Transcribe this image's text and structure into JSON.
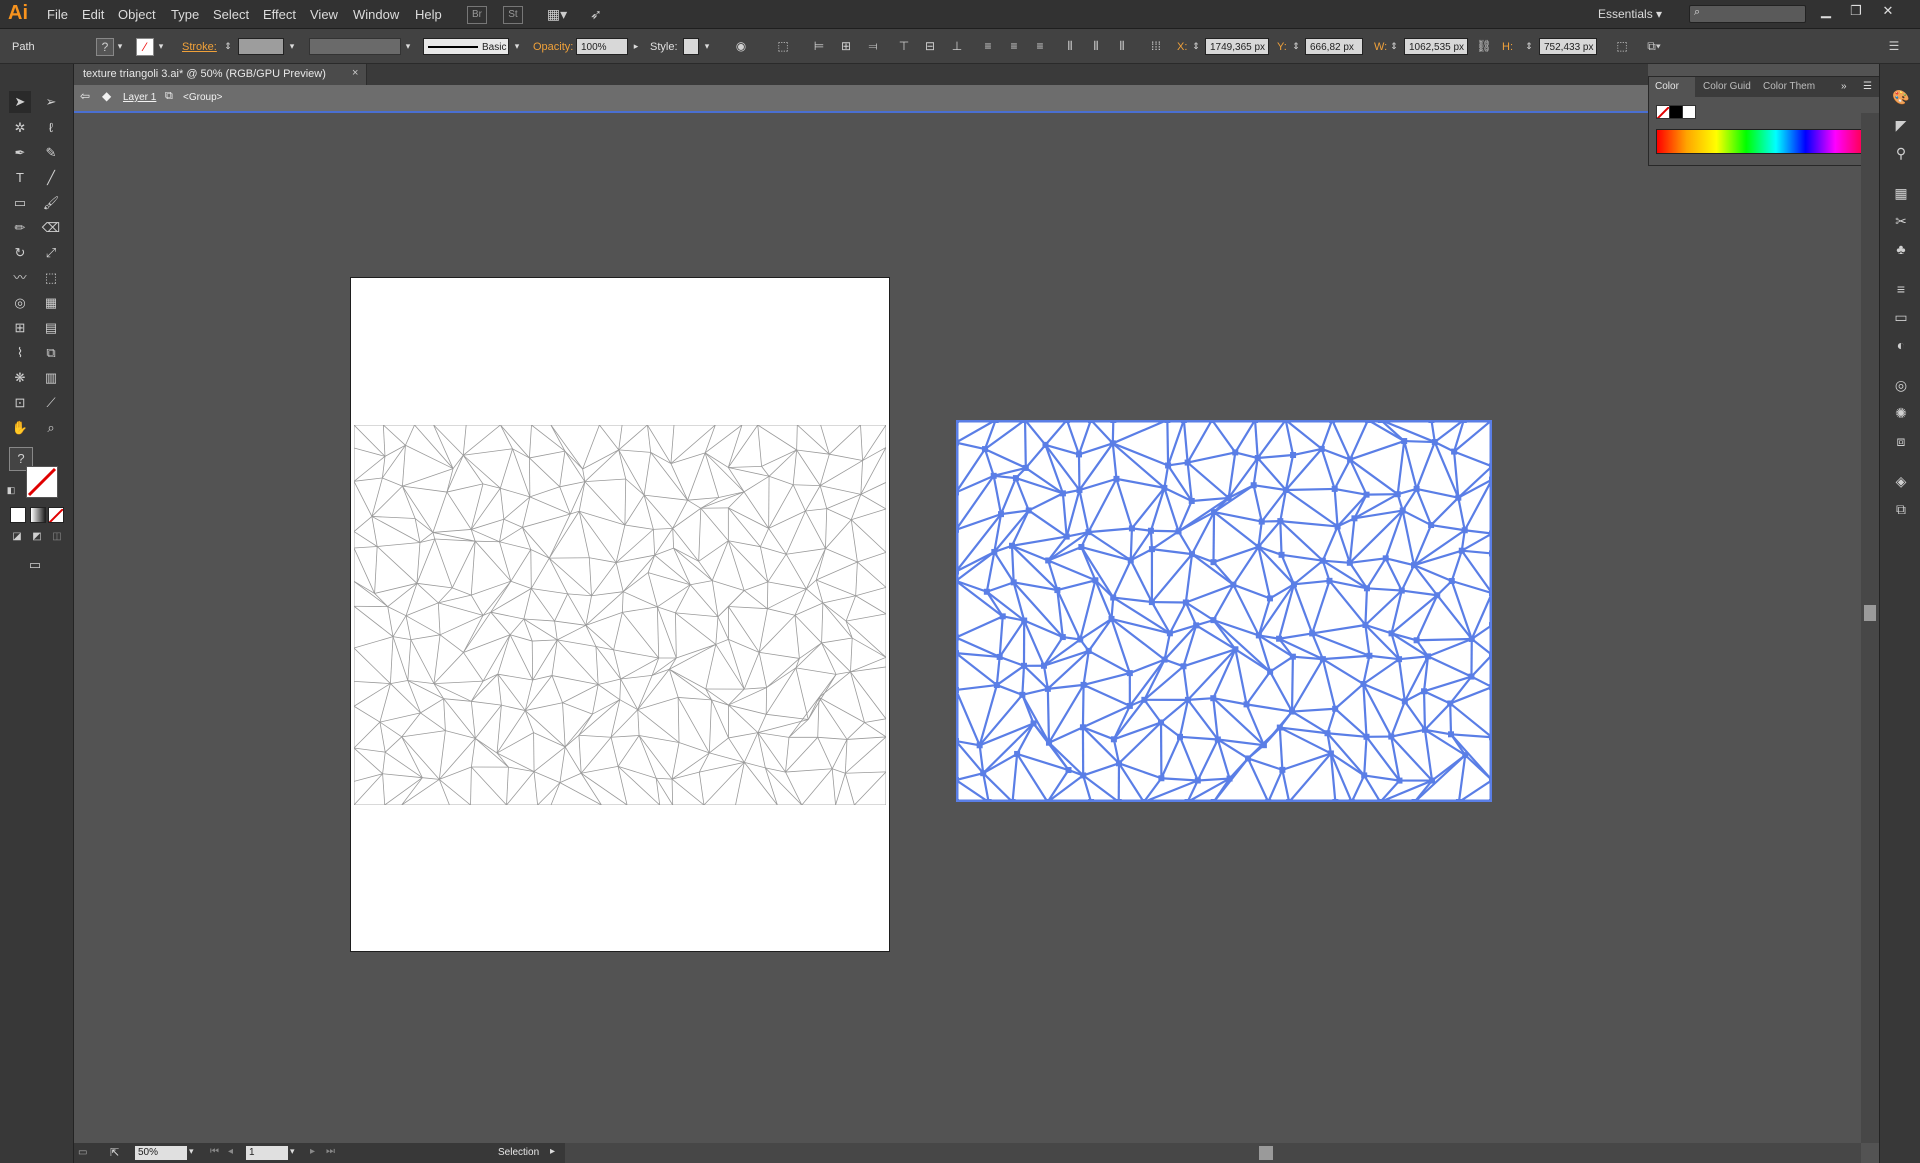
{
  "app": {
    "logo": "Ai",
    "menu": [
      "File",
      "Edit",
      "Object",
      "Type",
      "Select",
      "Effect",
      "View",
      "Window",
      "Help"
    ],
    "toolbar_icons": [
      "bridge-icon",
      "stock-icon",
      "arrange-documents-icon",
      "gpu-performance-icon"
    ],
    "workspace": "Essentials"
  },
  "control_bar": {
    "selection_type": "Path",
    "stroke_label": "Stroke:",
    "brush": "Basic",
    "opacity_label": "Opacity:",
    "opacity_value": "100%",
    "style_label": "Style:",
    "x_label": "X:",
    "x_value": "1749,365 px",
    "y_label": "Y:",
    "y_value": "666,82 px",
    "w_label": "W:",
    "w_value": "1062,535 px",
    "h_label": "H:",
    "h_value": "752,433 px"
  },
  "document": {
    "tab_title": "texture triangoli 3.ai* @ 50% (RGB/GPU Preview)",
    "close_glyph": "×",
    "layer": "Layer 1",
    "group": "<Group>"
  },
  "color_panel": {
    "tabs": [
      "Color",
      "Color Guid",
      "Color Them"
    ],
    "colors": {
      "black": "#000000",
      "white": "#ffffff"
    }
  },
  "status": {
    "zoom": "50%",
    "artboard_number": "1",
    "tool": "Selection"
  },
  "colors": {
    "selection_blue": "#5a7ee6",
    "mesh_gray": "#9a9a9a",
    "accent_orange": "#f7931e"
  }
}
